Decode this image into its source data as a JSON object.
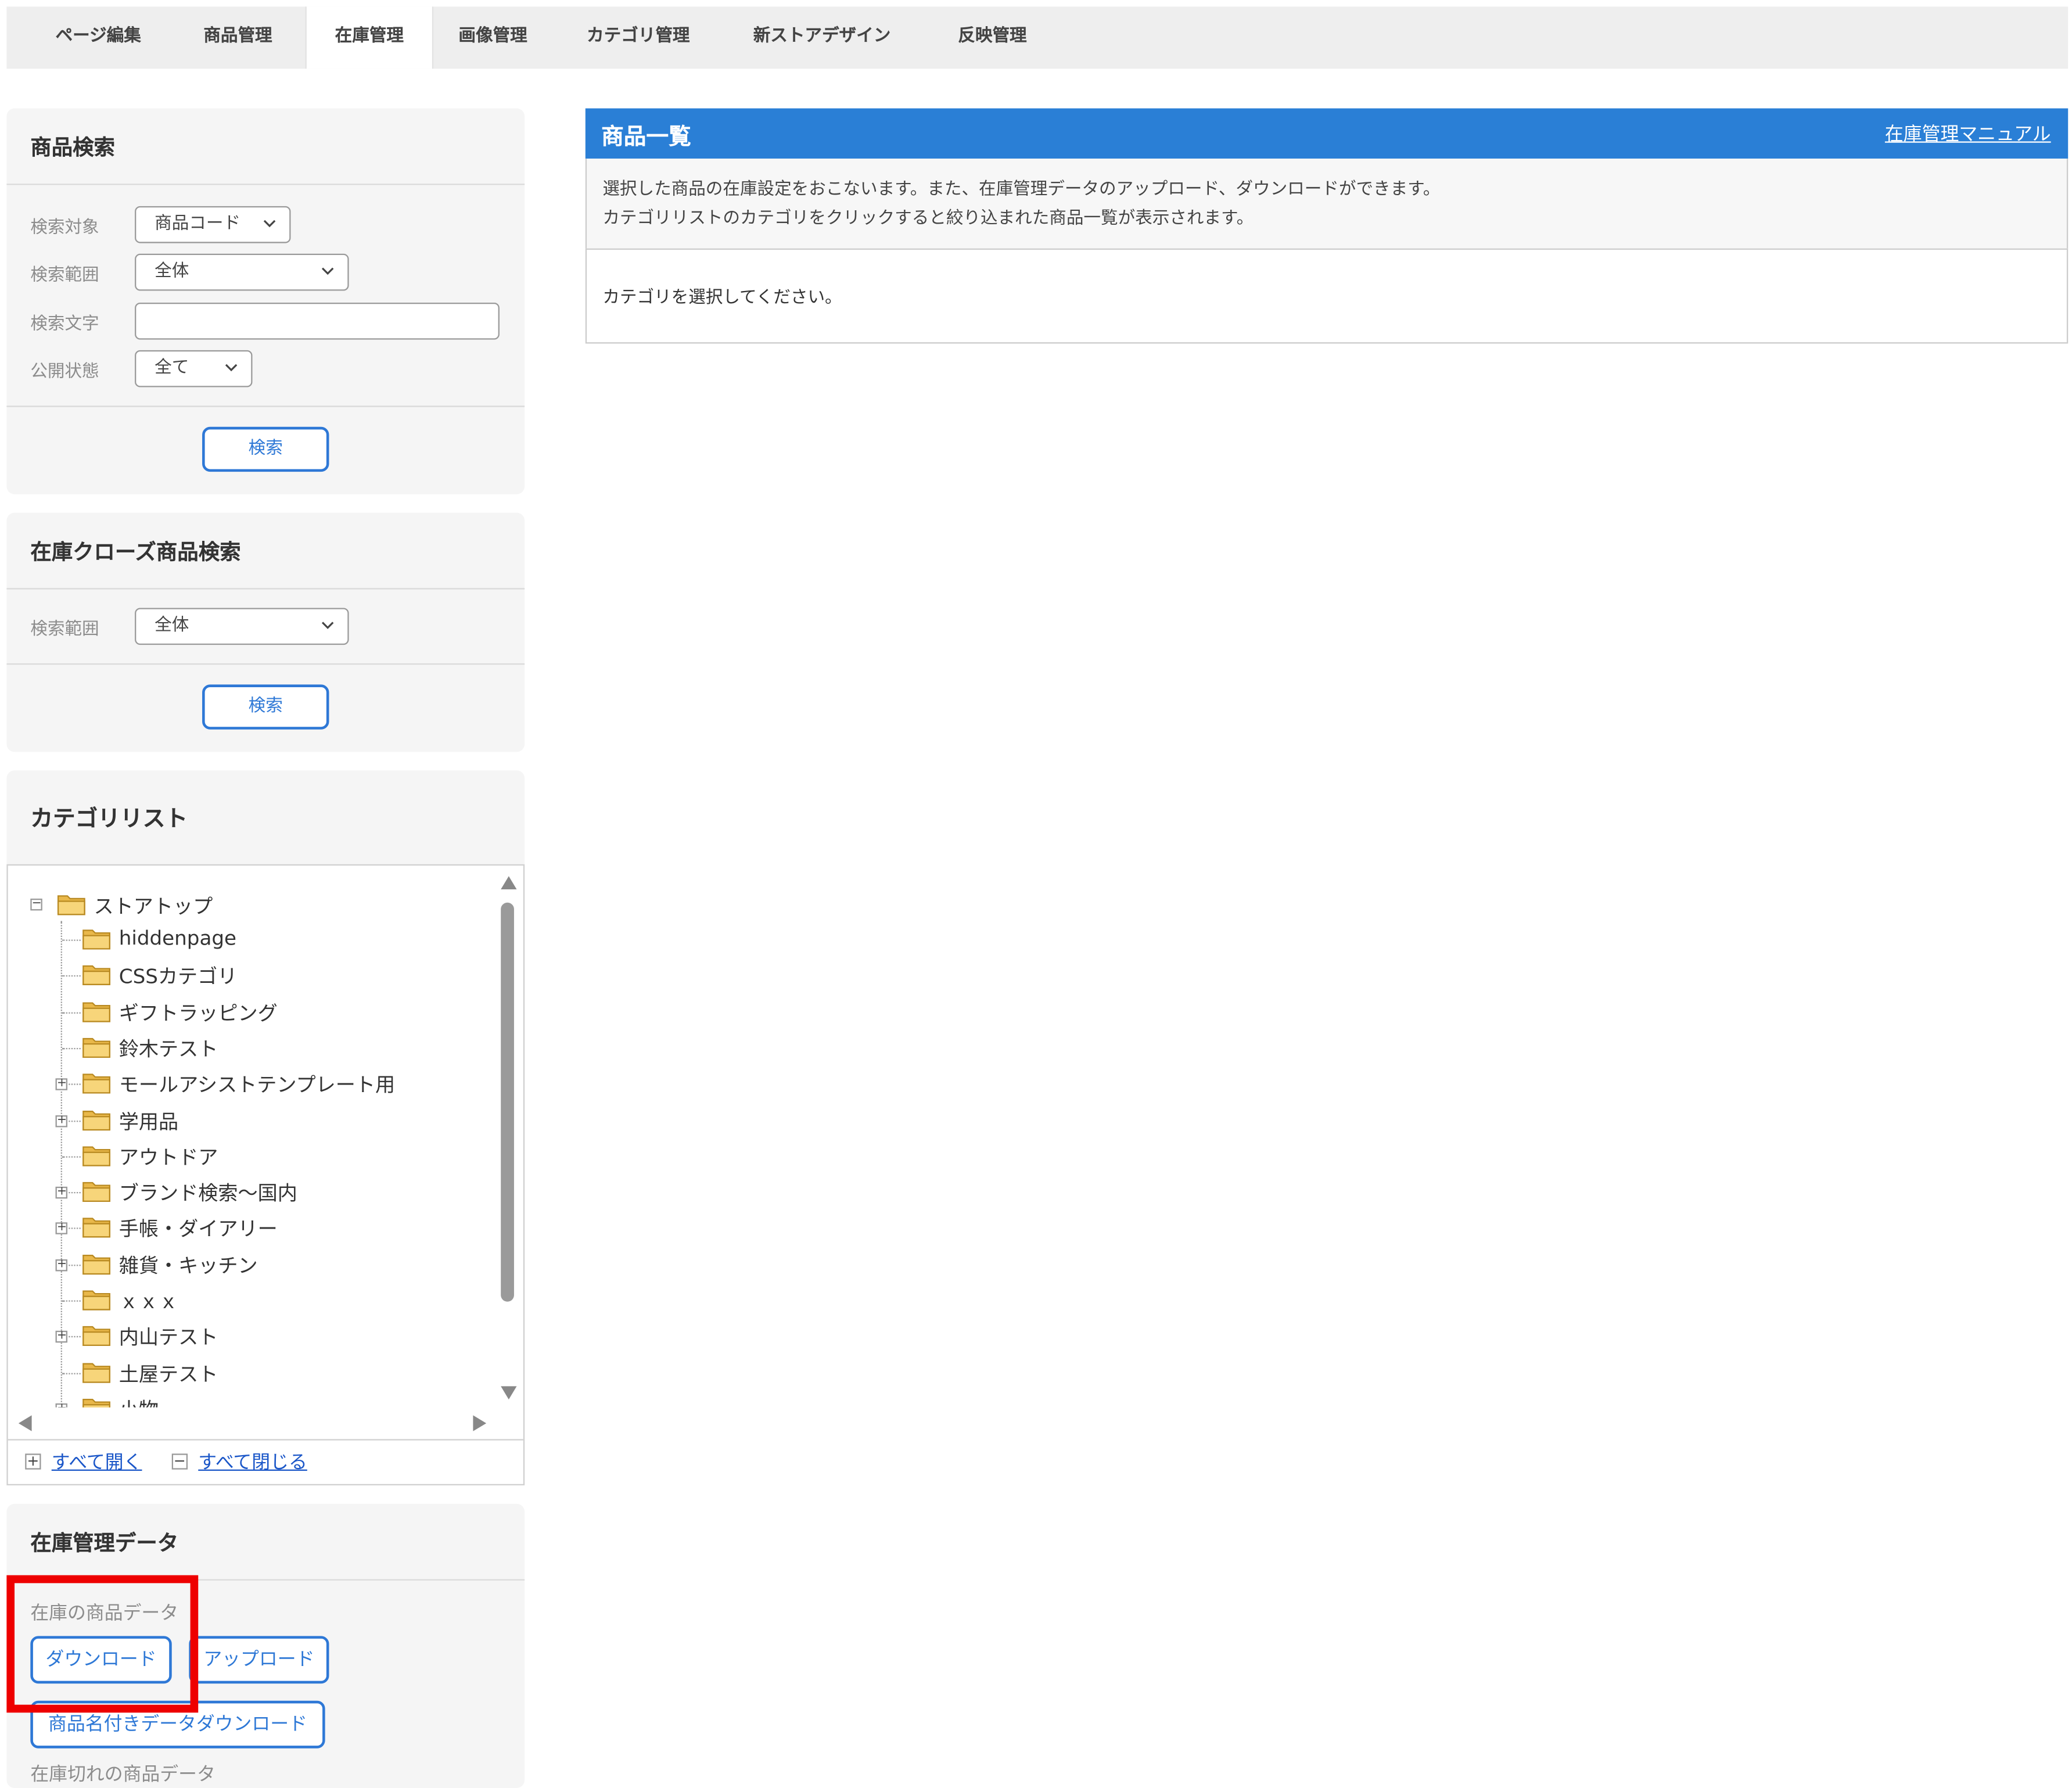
{
  "tabs": [
    "ページ編集",
    "商品管理",
    "在庫管理",
    "画像管理",
    "カテゴリ管理",
    "新ストアデザイン",
    "反映管理"
  ],
  "active_tab": "在庫管理",
  "product_search": {
    "title": "商品検索",
    "target_label": "検索対象",
    "target_value": "商品コード",
    "range_label": "検索範囲",
    "range_value": "全体",
    "text_label": "検索文字",
    "text_value": "",
    "status_label": "公開状態",
    "status_value": "全て",
    "search_button": "検索"
  },
  "closed_search": {
    "title": "在庫クローズ商品検索",
    "range_label": "検索範囲",
    "range_value": "全体",
    "search_button": "検索"
  },
  "category_list": {
    "title": "カテゴリリスト",
    "root": "ストアトップ",
    "items": [
      {
        "label": "hiddenpage",
        "expandable": false
      },
      {
        "label": "CSSカテゴリ",
        "expandable": false
      },
      {
        "label": "ギフトラッピング",
        "expandable": false
      },
      {
        "label": "鈴木テスト",
        "expandable": false
      },
      {
        "label": "モールアシストテンプレート用",
        "expandable": true
      },
      {
        "label": "学用品",
        "expandable": true
      },
      {
        "label": "アウトドア",
        "expandable": false
      },
      {
        "label": "ブランド検索〜国内",
        "expandable": true
      },
      {
        "label": "手帳・ダイアリー",
        "expandable": true
      },
      {
        "label": "雑貨・キッチン",
        "expandable": true
      },
      {
        "label": "ｘｘｘ",
        "expandable": false
      },
      {
        "label": "内山テスト",
        "expandable": true
      },
      {
        "label": "土屋テスト",
        "expandable": false
      },
      {
        "label": "小物",
        "expandable": true
      }
    ],
    "expand_all": "すべて開く",
    "collapse_all": "すべて閉じる"
  },
  "stock_data": {
    "title": "在庫管理データ",
    "products_label": "在庫の商品データ",
    "download_button": "ダウンロード",
    "upload_button": "アップロード",
    "named_download_button": "商品名付きデータダウンロード",
    "out_of_stock_label": "在庫切れの商品データ"
  },
  "main": {
    "title": "商品一覧",
    "manual_link": "在庫管理マニュアル",
    "desc_line1": "選択した商品の在庫設定をおこないます。また、在庫管理データのアップロード、ダウンロードができます。",
    "desc_line2": "カテゴリリストのカテゴリをクリックすると絞り込まれた商品一覧が表示されます。",
    "empty_message": "カテゴリを選択してください。"
  },
  "colors": {
    "accent": "#2a7fd6",
    "highlight": "#ee0000",
    "tab_bar": "#eeeeee",
    "panel_bg": "#f5f5f5"
  }
}
